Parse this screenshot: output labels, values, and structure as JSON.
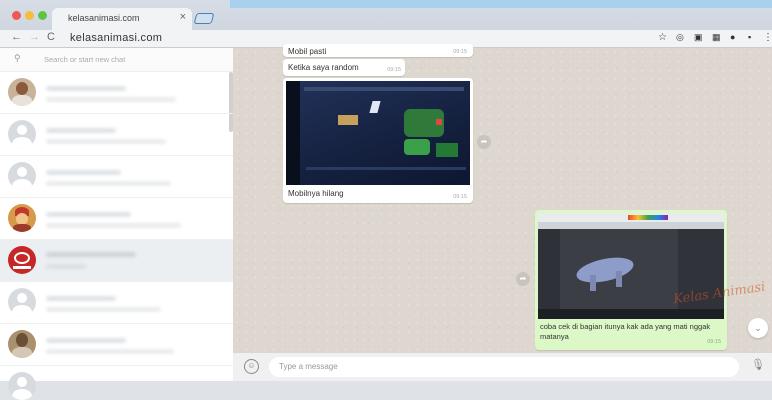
{
  "browser": {
    "tab_title": "kelasanimasi.com",
    "tab_close": "×",
    "url": "kelasanimasi.com",
    "back": "←",
    "forward": "→",
    "reload": "C",
    "star": "☆",
    "menu": "⋮"
  },
  "sidebar": {
    "search_placeholder": "Search or start new chat",
    "chats_count_visible": 8
  },
  "conversation": {
    "messages": [
      {
        "text": "Mobil pasti",
        "time": "09:15"
      },
      {
        "text": "Ketika saya random",
        "time": "09:15"
      },
      {
        "caption": "Mobilnya hilang",
        "time": "09:15"
      },
      {
        "caption": "coba cek di bagian itunya kak ada yang mati nggak matanya",
        "time": "09:15"
      }
    ],
    "watermark": "Kelas Animasi"
  },
  "compose": {
    "placeholder": "Type a message"
  },
  "colors": {
    "outgoing_bubble": "#dcf8c6",
    "incoming_bubble": "#ffffff",
    "chat_background": "#ddd7cf"
  },
  "icons": [
    "search-icon",
    "emoji-icon",
    "mic-icon",
    "forward-icon",
    "chevron-down-icon",
    "star-icon",
    "menu-icon"
  ]
}
